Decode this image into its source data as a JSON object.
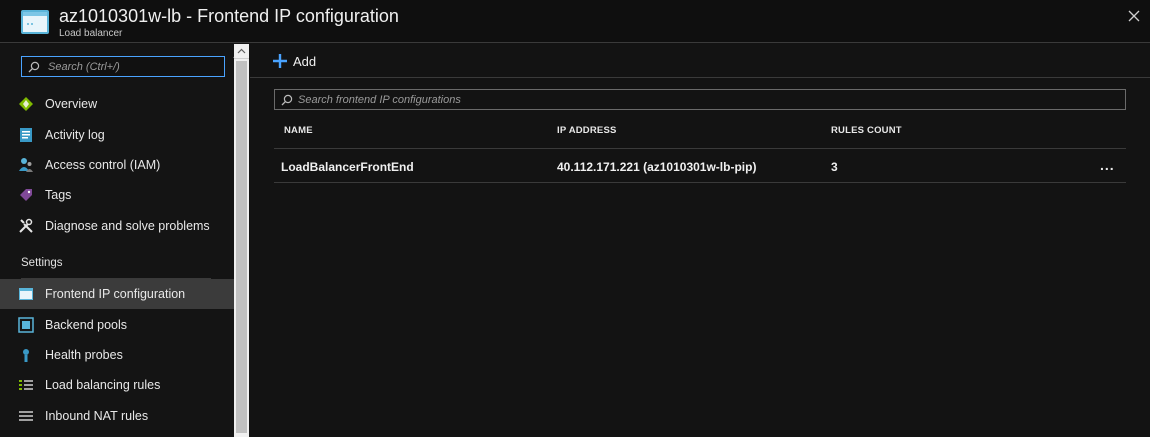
{
  "header": {
    "title": "az1010301w-lb - Frontend IP configuration",
    "subtitle": "Load balancer"
  },
  "sidebar": {
    "search_placeholder": "Search (Ctrl+/)",
    "collapse_glyph": "«",
    "items": [
      {
        "label": "Overview",
        "icon": "overview-icon"
      },
      {
        "label": "Activity log",
        "icon": "activity-log-icon"
      },
      {
        "label": "Access control (IAM)",
        "icon": "iam-icon"
      },
      {
        "label": "Tags",
        "icon": "tag-icon"
      },
      {
        "label": "Diagnose and solve problems",
        "icon": "wrench-icon"
      }
    ],
    "section_title": "Settings",
    "settings_items": [
      {
        "label": "Frontend IP configuration",
        "icon": "frontend-ip-icon",
        "active": true
      },
      {
        "label": "Backend pools",
        "icon": "backend-pool-icon"
      },
      {
        "label": "Health probes",
        "icon": "health-probe-icon"
      },
      {
        "label": "Load balancing rules",
        "icon": "lb-rules-icon"
      },
      {
        "label": "Inbound NAT rules",
        "icon": "nat-rules-icon"
      }
    ]
  },
  "toolbar": {
    "add_label": "Add"
  },
  "filter": {
    "placeholder": "Search frontend IP configurations"
  },
  "table": {
    "columns": [
      "NAME",
      "IP ADDRESS",
      "RULES COUNT"
    ],
    "rows": [
      {
        "name": "LoadBalancerFrontEnd",
        "ip": "40.112.171.221 (az1010301w-lb-pip)",
        "rules": "3",
        "more": "..."
      }
    ]
  },
  "colors": {
    "accent": "#4aa3ff",
    "background": "#131313",
    "active_item": "#3b3b3b"
  }
}
